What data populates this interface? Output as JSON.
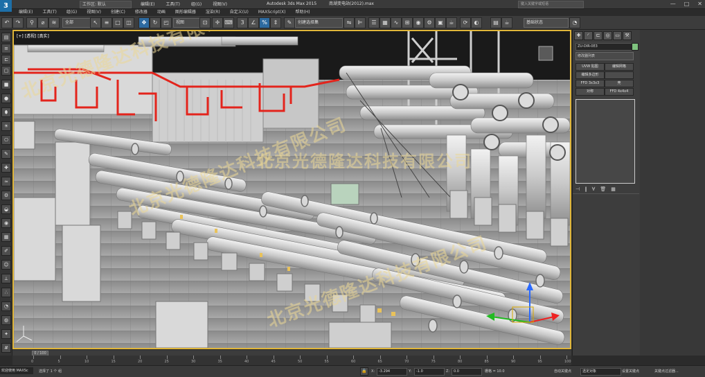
{
  "app": {
    "logo": "3",
    "workspace": "工作区: 默认",
    "app_title": "Autodesk 3ds Max  2015",
    "file_title": "南湖变电站(2012).max",
    "search_placeholder": "键入关键字或短语",
    "menu": [
      "编辑(E)",
      "工具(T)",
      "组(G)",
      "视图(V)",
      "创建(C)",
      "修改器",
      "动画",
      "图形编辑器",
      "渲染(R)",
      "自定义(U)",
      "MAXScript(X)",
      "帮助(H)"
    ],
    "window_buttons": [
      "—",
      "□",
      "✕"
    ]
  },
  "toolbar": {
    "selection_filter": "全部",
    "ref_coord": "视图",
    "named_selection": "创建选择集",
    "render_preset": "基础状态"
  },
  "viewport": {
    "label": "[+] [透视] [真实]",
    "watermark": "北京光德隆达科技有限公司",
    "accent_border": "#e0b63a"
  },
  "command_panel": {
    "object_name": "ZU-DIR-0E3",
    "modifier_list": "修改器列表",
    "buttons": [
      "UVW 贴图",
      "编辑多边形",
      "编辑多边形",
      "FFD 3x3x3",
      "壳",
      "对称",
      "编辑样条线"
    ],
    "buttons_left": [
      "UVW 贴图",
      "编辑多边形",
      "FFD 3x3x3",
      "对称"
    ],
    "buttons_right": [
      "编辑网格",
      "",
      "壳",
      "FFD 4x4x4"
    ]
  },
  "timeline": {
    "frame": "0 / 100",
    "ticks": [
      "0",
      "5",
      "10",
      "15",
      "20",
      "25",
      "30",
      "35",
      "40",
      "45",
      "50",
      "55",
      "60",
      "65",
      "70",
      "75",
      "80",
      "85",
      "90",
      "95",
      "100"
    ]
  },
  "status": {
    "maxscript": "欢迎使用 MAXSc",
    "selection_text": "选择了 1 个 组",
    "x_label": "X:",
    "x_value": "-3.294",
    "y_label": "Y:",
    "y_value": "-1.0",
    "z_label": "Z:",
    "z_value": "0.0",
    "grid": "栅格 = 10.0",
    "autokey": "自动关键点",
    "selected": "选定对象",
    "setkey": "设置关键点",
    "filters": "关键点过滤器..."
  }
}
